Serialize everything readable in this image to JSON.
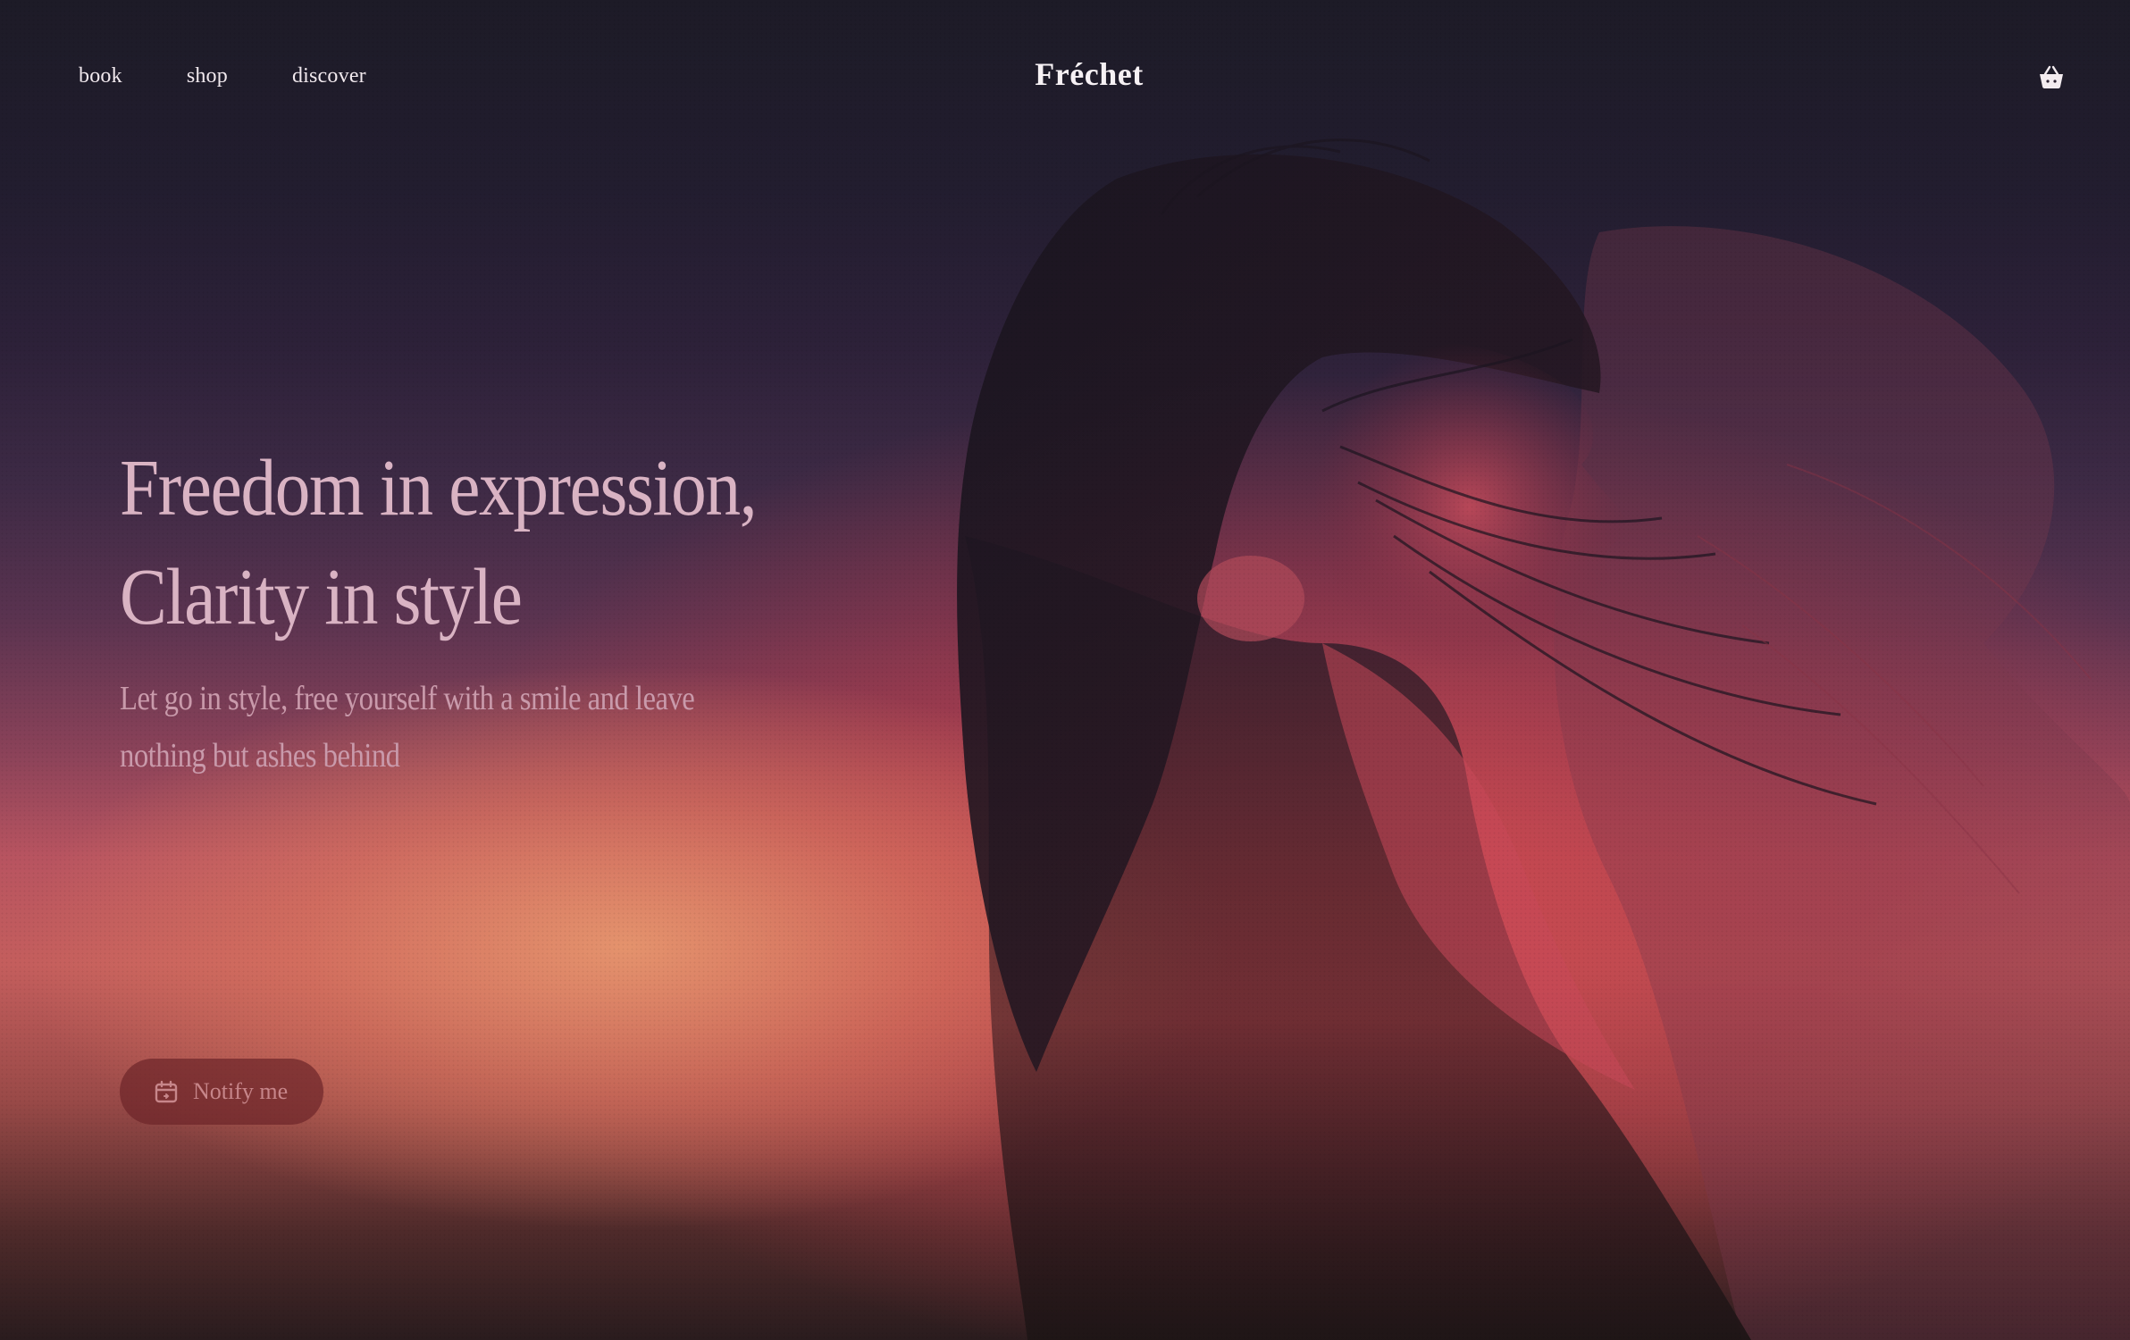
{
  "nav": {
    "links": [
      {
        "label": "book"
      },
      {
        "label": "shop"
      },
      {
        "label": "discover"
      }
    ],
    "brand": "Fréchet",
    "cart_icon": "basket-icon"
  },
  "hero": {
    "headline_line1": "Freedom in expression,",
    "headline_line2": "Clarity in style",
    "subhead_line1": "Let go in style, free yourself with a smile and leave",
    "subhead_line2": "nothing but ashes behind",
    "cta_label": "Notify me",
    "cta_icon": "calendar-icon"
  },
  "colors": {
    "headline": "#d9b3c3",
    "subhead": "#c99aab",
    "cta_background": "#6e262a",
    "nav_text": "#f1e9ee"
  }
}
